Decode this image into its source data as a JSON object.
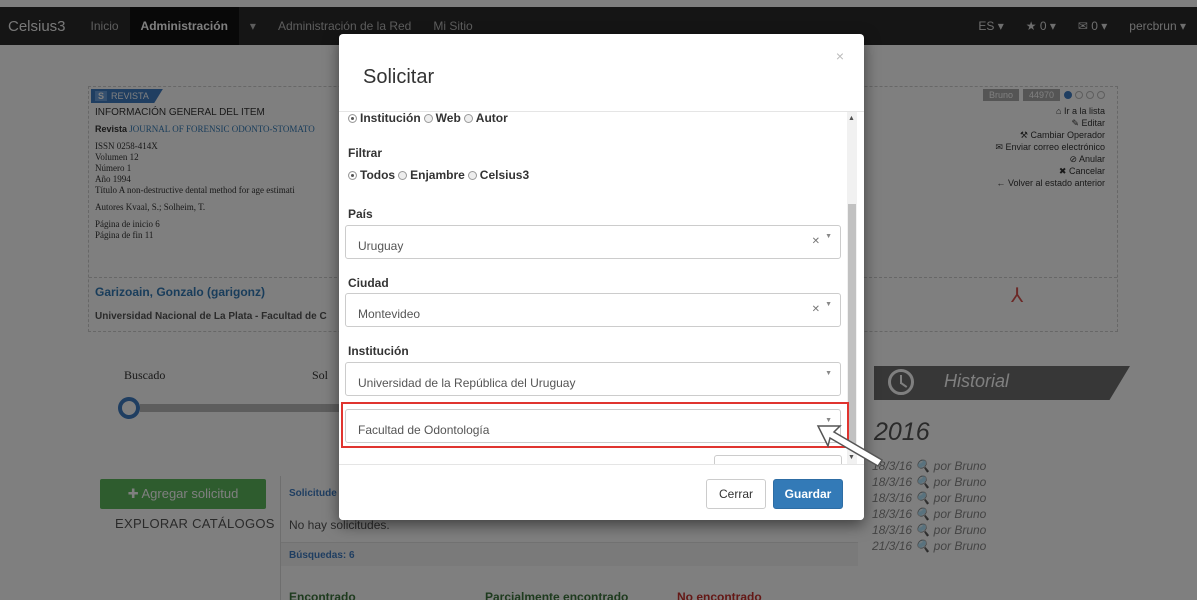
{
  "navbar": {
    "brand": "Celsius3",
    "items": [
      "Inicio",
      "Administración",
      "▾",
      "Administración de la Red",
      "Mi Sitio"
    ],
    "right": [
      "ES ▾",
      "★ 0 ▾",
      "✉ 0 ▾",
      "percbrun ▾"
    ]
  },
  "panel": {
    "tag_letter": "S",
    "tag_label": "REVISTA",
    "header": "INFORMACIÓN GENERAL DEL ITEM",
    "revista_label": "Revista",
    "revista_value": "JOURNAL OF FORENSIC ODONTO-STOMATO",
    "issn": "ISSN 0258-414X",
    "volumen": "Volumen 12",
    "numero": "Número 1",
    "anio": "Año 1994",
    "titulo": "Título A non-destructive dental method for age estimati",
    "autores": "Autores Kvaal, S.; Solheim, T.",
    "pagina_inicio": "Página de inicio 6",
    "pagina_fin": "Página de fin 11",
    "user": "Garizoain, Gonzalo (garigonz)",
    "univ": "Universidad Nacional de La Plata - Facultad de C",
    "operator": "Bruno",
    "id": "44970",
    "actions": [
      "Ir a la lista",
      "Editar",
      "Cambiar Operador",
      "Enviar correo electrónico",
      "Anular",
      "Cancelar",
      "Volver al estado anterior"
    ]
  },
  "progress": {
    "buscado": "Buscado",
    "sol": "Sol"
  },
  "bottom": {
    "add_button": "Agregar solicitud",
    "explore": "EXPLORAR CATÁLOGOS",
    "solicitudes": "Solicitude",
    "no_solicitudes": "No hay solicitudes.",
    "busquedas": "Búsquedas: 6",
    "encontrado": "Encontrado",
    "parcial": "Parcialmente encontrado",
    "no_encontrado": "No encontrado"
  },
  "historial": {
    "title": "Historial",
    "year": "2016",
    "entries": [
      "18/3/16 🔍 por Bruno",
      "18/3/16 🔍 por Bruno",
      "18/3/16 🔍 por Bruno",
      "18/3/16 🔍 por Bruno",
      "18/3/16 🔍 por Bruno",
      "21/3/16 🔍 por Bruno"
    ]
  },
  "modal": {
    "title": "Solicitar",
    "close": "×",
    "tipo_options": [
      "Institución",
      "Web",
      "Autor"
    ],
    "filtrar_label": "Filtrar",
    "filtrar_options": [
      "Todos",
      "Enjambre",
      "Celsius3"
    ],
    "pais_label": "País",
    "pais_value": "Uruguay",
    "ciudad_label": "Ciudad",
    "ciudad_value": "Montevideo",
    "institucion_label": "Institución",
    "institucion_value": "Universidad de la República del Uruguay",
    "dependencia_value": "Facultad de Odontología",
    "cerrar": "Cerrar",
    "guardar": "Guardar"
  },
  "colors": {
    "primary": "#337ab7",
    "success": "#5cb85c",
    "highlight": "#e0342f",
    "navbar": "#2b2b2b"
  }
}
